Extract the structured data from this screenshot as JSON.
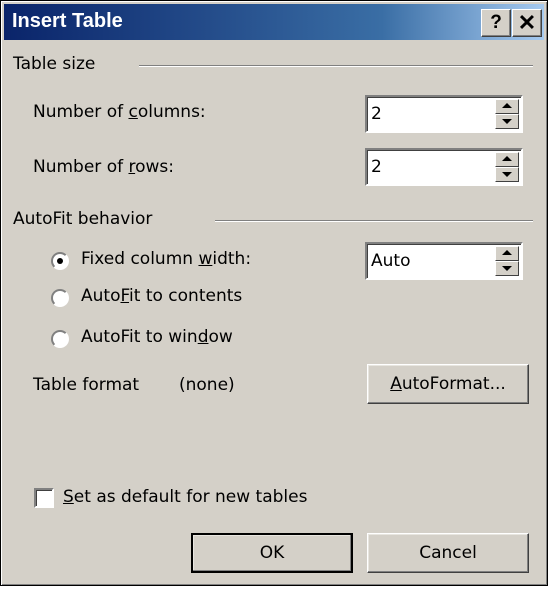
{
  "window": {
    "title": "Insert Table",
    "help_glyph": "?",
    "close_glyph": "✕"
  },
  "table_size": {
    "group_label": "Table size",
    "columns_label_pre": "Number of ",
    "columns_label_acc": "c",
    "columns_label_post": "olumns:",
    "columns_value": "2",
    "rows_label_pre": "Number of ",
    "rows_label_acc": "r",
    "rows_label_post": "ows:",
    "rows_value": "2"
  },
  "autofit": {
    "group_label": "AutoFit behavior",
    "fixed_pre": "Fixed column ",
    "fixed_acc": "w",
    "fixed_post": "idth:",
    "fixed_value": "Auto",
    "contents_pre": "Auto",
    "contents_acc": "F",
    "contents_post": "it to contents",
    "window_pre": "AutoFit to win",
    "window_acc": "d",
    "window_post": "ow",
    "selected": "fixed"
  },
  "table_format": {
    "label": "Table format",
    "value": "(none)",
    "button_acc": "A",
    "button_post": "utoFormat..."
  },
  "default_checkbox": {
    "acc": "S",
    "post": "et as default for new tables",
    "checked": false
  },
  "buttons": {
    "ok": "OK",
    "cancel": "Cancel"
  }
}
